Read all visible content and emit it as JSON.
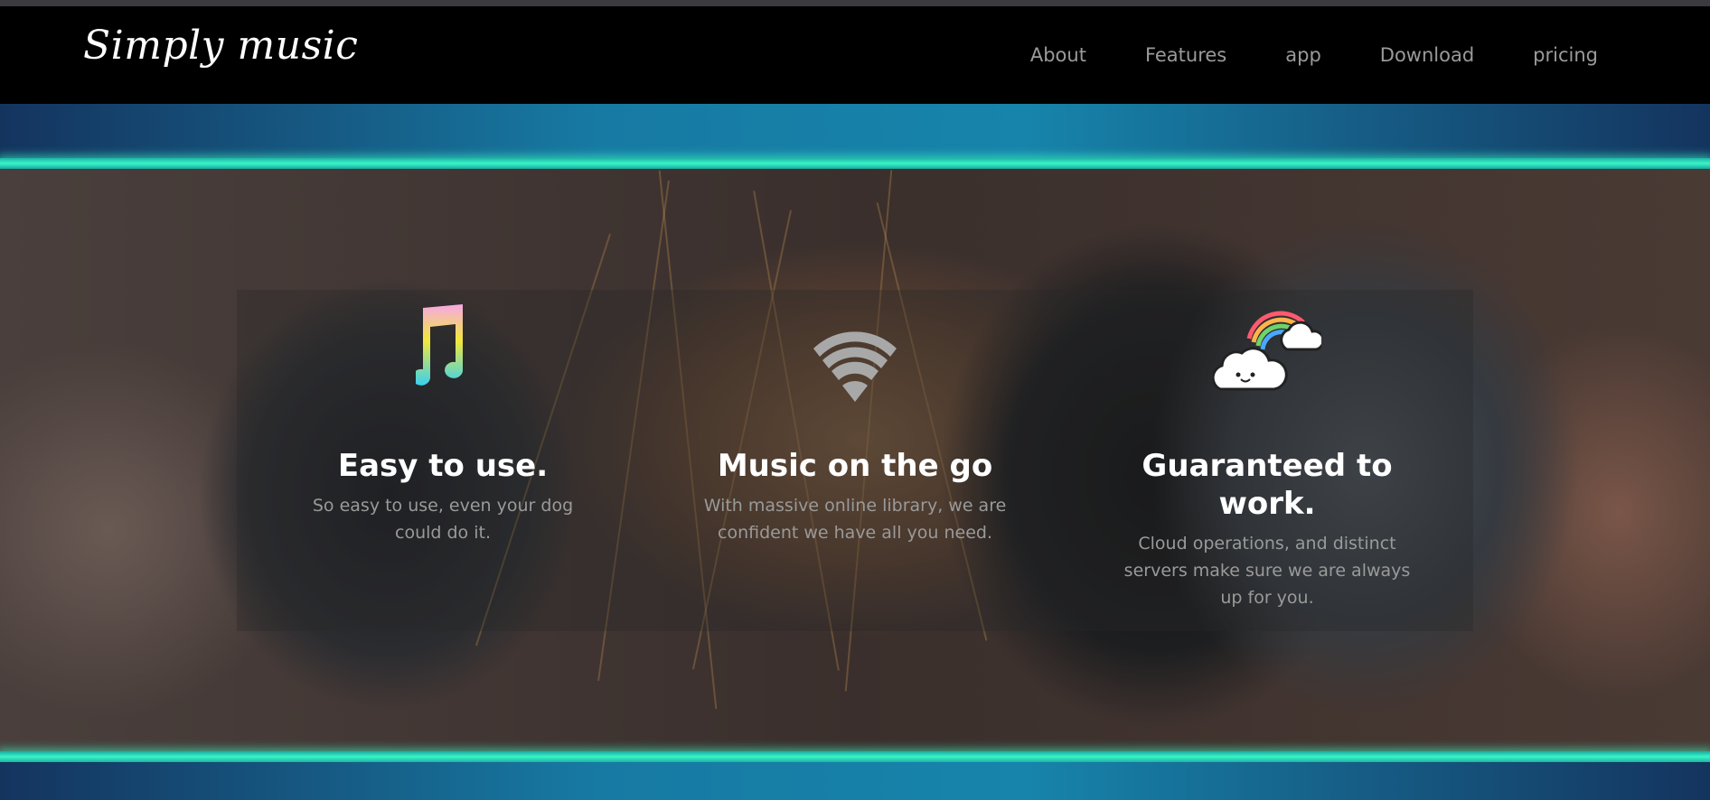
{
  "brand": {
    "logo_text": "Simply music"
  },
  "nav": {
    "items": [
      {
        "label": "About"
      },
      {
        "label": "Features"
      },
      {
        "label": "app"
      },
      {
        "label": "Download"
      },
      {
        "label": "pricing"
      }
    ]
  },
  "features": [
    {
      "icon": "music-note-icon",
      "title": "Easy to use.",
      "text": "So easy to use, even your dog could do it."
    },
    {
      "icon": "wifi-icon",
      "title": "Music on the go",
      "text": "With massive online library, we are confident we have all you need."
    },
    {
      "icon": "cloud-rainbow-icon",
      "title": "Guaranteed to work.",
      "text": "Cloud operations, and distinct servers make sure we are always up for you."
    }
  ],
  "colors": {
    "accent_glow": "#38f5c7",
    "band_blue": "#177aa3",
    "navbar_bg": "#000000",
    "nav_link": "#9a9a9a"
  }
}
